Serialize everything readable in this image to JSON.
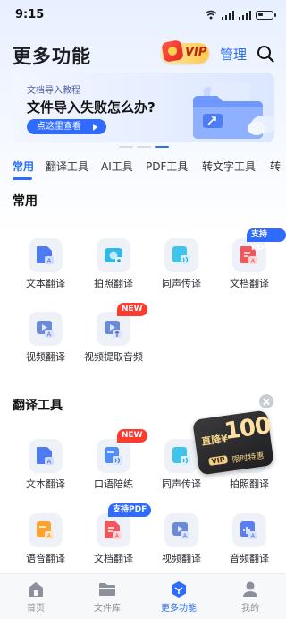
{
  "status_bar": {
    "time": "9:15"
  },
  "header": {
    "title": "更多功能",
    "vip_label": "VIP",
    "manage_label": "管理"
  },
  "banner": {
    "subtitle": "文档导入教程",
    "title": "文件导入失败怎么办?",
    "button_label": "点这里查看"
  },
  "tabs": [
    "常用",
    "翻译工具",
    "AI工具",
    "PDF工具",
    "转文字工具",
    "转"
  ],
  "sections": {
    "common": {
      "title": "常用",
      "items": [
        {
          "label": "文本翻译",
          "icon": "text-translate-icon"
        },
        {
          "label": "拍照翻译",
          "icon": "camera-translate-icon"
        },
        {
          "label": "同声传译",
          "icon": "simultaneous-interpret-icon"
        },
        {
          "label": "文档翻译",
          "icon": "document-translate-icon",
          "tag": "支持PDF"
        },
        {
          "label": "视频翻译",
          "icon": "video-translate-icon"
        },
        {
          "label": "视频提取音频",
          "icon": "video-extract-audio-icon",
          "tag": "NEW"
        }
      ]
    },
    "translate_tools": {
      "title": "翻译工具",
      "items": [
        {
          "label": "文本翻译",
          "icon": "text-translate-icon"
        },
        {
          "label": "口语陪练",
          "icon": "speaking-practice-icon",
          "tag": "NEW"
        },
        {
          "label": "同声传译",
          "icon": "simultaneous-interpret-icon"
        },
        {
          "label": "拍照翻译",
          "icon": "camera-translate-icon"
        },
        {
          "label": "语音翻译",
          "icon": "voice-translate-icon"
        },
        {
          "label": "文档翻译",
          "icon": "document-translate-icon",
          "tag": "支持PDF"
        },
        {
          "label": "视频翻译",
          "icon": "video-translate-icon"
        },
        {
          "label": "音频翻译",
          "icon": "audio-translate-icon"
        }
      ]
    }
  },
  "promo": {
    "prefix": "直降¥",
    "amount": "100",
    "vip": "VIP",
    "subtitle": "限时特惠"
  },
  "bottom_nav": [
    {
      "label": "首页",
      "icon": "home-icon"
    },
    {
      "label": "文件库",
      "icon": "folder-icon"
    },
    {
      "label": "更多功能",
      "icon": "more-features-icon",
      "active": true
    },
    {
      "label": "我的",
      "icon": "profile-icon"
    }
  ],
  "colors": {
    "accent": "#2f6bff",
    "new_tag": "#ff3b2f",
    "vip_gold": "#ffc94d"
  }
}
